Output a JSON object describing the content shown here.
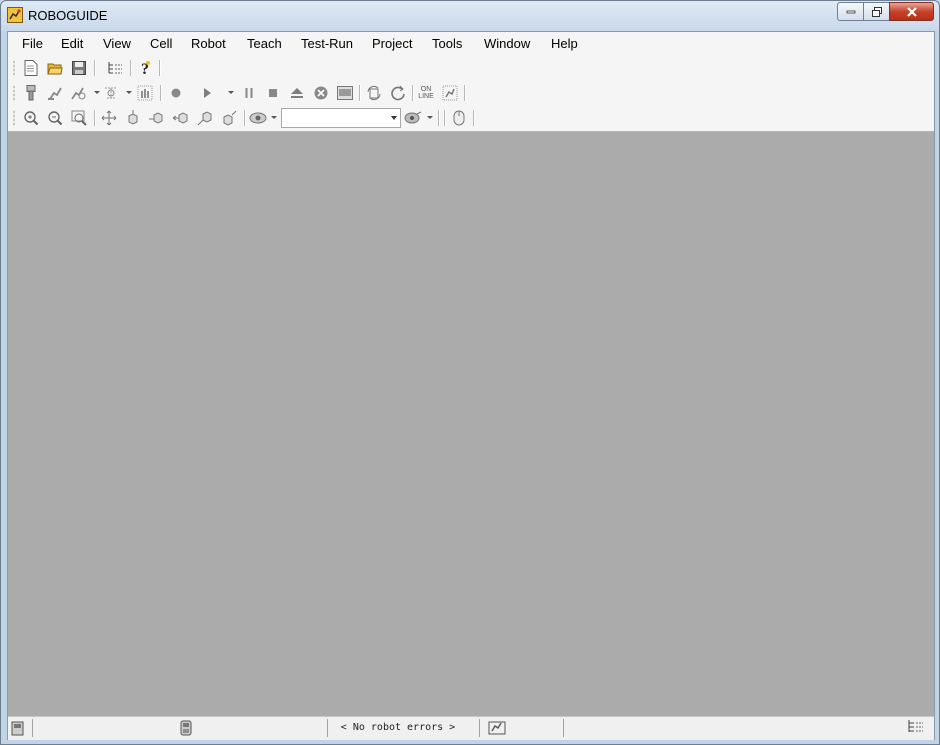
{
  "window": {
    "title": "ROBOGUIDE"
  },
  "menu": [
    "File",
    "Edit",
    "View",
    "Cell",
    "Robot",
    "Teach",
    "Test-Run",
    "Project",
    "Tools",
    "Window",
    "Help"
  ],
  "toolbar2": {
    "online_top": "ON",
    "online_bottom": "LINE"
  },
  "toolbar3": {
    "selector_value": ""
  },
  "statusbar": {
    "message": "< No robot errors >"
  },
  "colors": {
    "workspace": "#ababab",
    "menubar": "#f5f5f5",
    "titlebar": "#c9d8ea",
    "close_button": "#c7432b"
  }
}
